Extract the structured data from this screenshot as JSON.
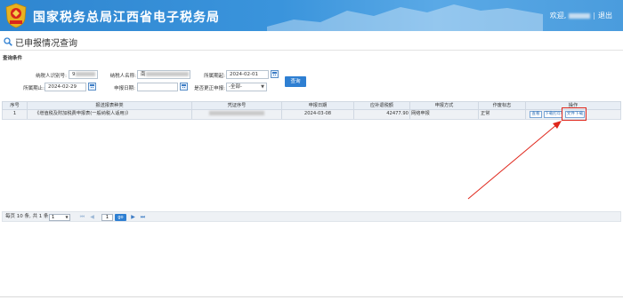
{
  "header": {
    "title": "国家税务总局江西省电子税务局",
    "welcome_label": "欢迎,",
    "separator": "|",
    "logout_label": "退出"
  },
  "page": {
    "title": "已申报情况查询",
    "section_label": "查询条件"
  },
  "form": {
    "taxpayer_id_label": "纳税人识别号:",
    "taxpayer_id_value": "9",
    "taxpayer_name_label": "纳税人名称:",
    "taxpayer_name_value": "南",
    "period_start_label": "所属期起:",
    "period_start_value": "2024-02-01",
    "period_end_label": "所属期止:",
    "period_end_value": "2024-02-29",
    "declare_date_label": "申报日期:",
    "declare_date_value": "",
    "correction_label": "是否更正申报:",
    "correction_value": "-全部-",
    "query_button": "查询"
  },
  "table": {
    "columns": [
      "序号",
      "报送报表种类",
      "凭证序号",
      "申报日期",
      "应补退税额",
      "申报方式",
      "作废标志",
      "操作"
    ],
    "rows": [
      {
        "index": "1",
        "form_type": "《增值税及附加税费申报表(一般纳税人适用)》",
        "voucher_no": "",
        "declare_date": "2024-03-08",
        "tax_amount": "42477.90",
        "declare_method": "网络申报",
        "void_flag": "正常",
        "actions": [
          "查看",
          "下载打印",
          "文件下载"
        ]
      }
    ]
  },
  "pager": {
    "per_page_text": "每页 10 条, 共 1 条",
    "page_size": "1",
    "current_page": "1",
    "go_label": "go",
    "first_icon": "⏮",
    "prev_icon": "◀",
    "next_icon": "▶",
    "last_icon": "⏭"
  },
  "colors": {
    "header_blue": "#3a94dc",
    "button_blue": "#2e7fd2",
    "annotation_red": "#e0261b"
  },
  "icons": {
    "emblem": "tax-bureau-emblem-icon",
    "search": "search-icon",
    "calendar": "calendar-icon",
    "dropdown": "chevron-down-icon",
    "annotation_arrow": "red-arrow-icon"
  }
}
